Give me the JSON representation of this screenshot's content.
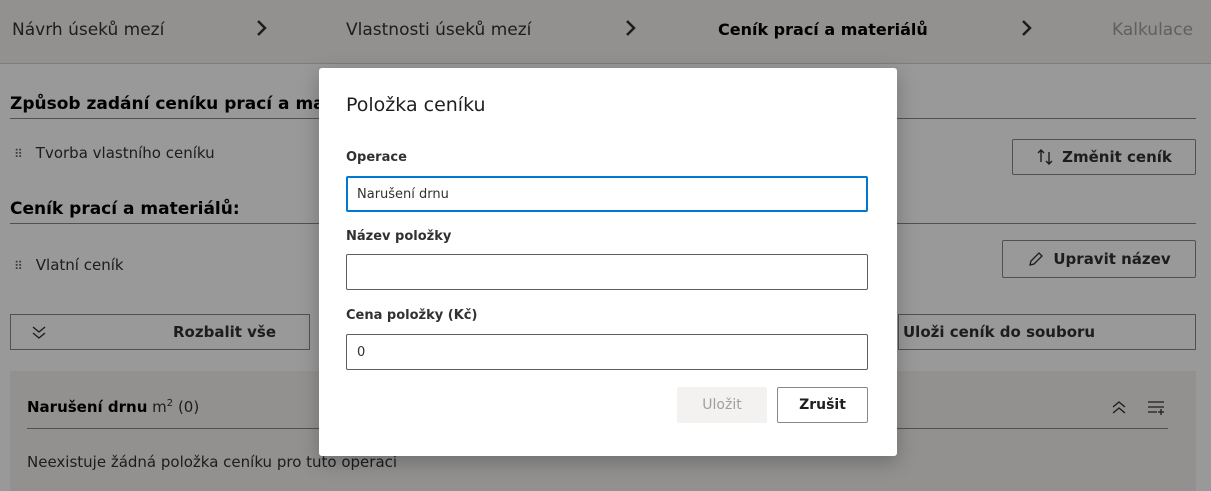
{
  "wizard": {
    "steps": [
      {
        "label": "Návrh úseků mezí",
        "state": "done"
      },
      {
        "label": "Vlastnosti úseků mezí",
        "state": "done"
      },
      {
        "label": "Ceník prací a materiálů",
        "state": "current"
      },
      {
        "label": "Kalkulace",
        "state": "future"
      }
    ],
    "separator": "›"
  },
  "pricing_method": {
    "heading": "Způsob zadání ceníku prací a materiálů",
    "value": "Tvorba vlastního ceníku",
    "change_button": "Změnit ceník"
  },
  "pricing_list": {
    "heading": "Ceník prací a materiálů:",
    "value": "Vlatní ceník",
    "rename_button": "Upravit název"
  },
  "toolbar": {
    "expand_all": "Rozbalit vše",
    "save_to_file": "Uloži ceník do souboru"
  },
  "operation": {
    "name": "Narušení drnu",
    "unit": "m",
    "unit_exponent": "2",
    "count": "(0)",
    "empty_message": "Neexistuje žádná položka ceníku pro tuto operaci"
  },
  "modal": {
    "title": "Položka ceníku",
    "operation_label": "Operace",
    "operation_value": "Narušení drnu",
    "name_label": "Název položky",
    "name_value": "",
    "price_label": "Cena položky (Kč)",
    "price_value": "0",
    "save_button": "Uložit",
    "cancel_button": "Zrušit"
  },
  "colors": {
    "accent": "#0078d4",
    "overlay": "rgba(0,0,0,0.4)",
    "panel_bg": "#f3f2f1",
    "disabled_text": "#a19f9d"
  }
}
